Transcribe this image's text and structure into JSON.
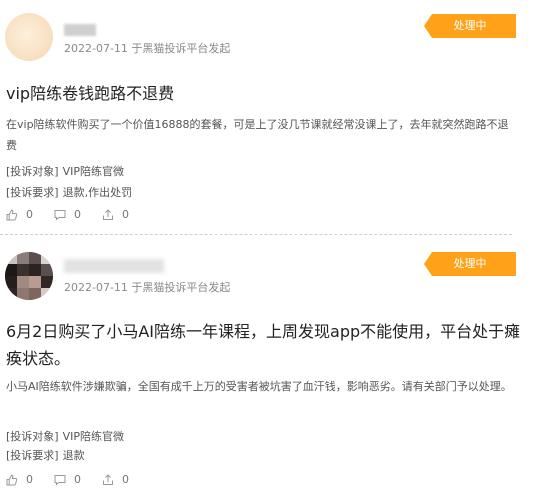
{
  "complaints": [
    {
      "meta": "2022-07-11 于黑猫投诉平台发起",
      "status": "处理中",
      "title": "vip陪练卷钱跑路不退费",
      "description": "在vip陪练软件购买了一个价值16888的套餐，可是上了没几节课就经常没课上了，去年就突然跑路不退费",
      "target_label": "[投诉对象]",
      "target_value": "VIP陪练官微",
      "demand_label": "[投诉要求]",
      "demand_value": "退款,作出处罚",
      "likes": "0",
      "comments": "0",
      "shares": "0"
    },
    {
      "meta": "2022-07-11 于黑猫投诉平台发起",
      "status": "处理中",
      "title": "6月2日购买了小马AI陪练一年课程，上周发现app不能使用，平台处于瘫痪状态。",
      "description": "小马AI陪练软件涉嫌欺骗，全国有成千上万的受害者被坑害了血汗钱，影响恶劣。请有关部门予以处理。",
      "target_label": "[投诉对象]",
      "target_value": "VIP陪练官微",
      "demand_label": "[投诉要求]",
      "demand_value": "退款",
      "likes": "0",
      "comments": "0",
      "shares": "0"
    }
  ],
  "icons": {
    "like": "thumbs-up-icon",
    "comment": "comment-bubble-icon",
    "share": "share-icon"
  },
  "colors": {
    "status_badge": "#ffa21a",
    "divider": "#cfcfcf"
  }
}
